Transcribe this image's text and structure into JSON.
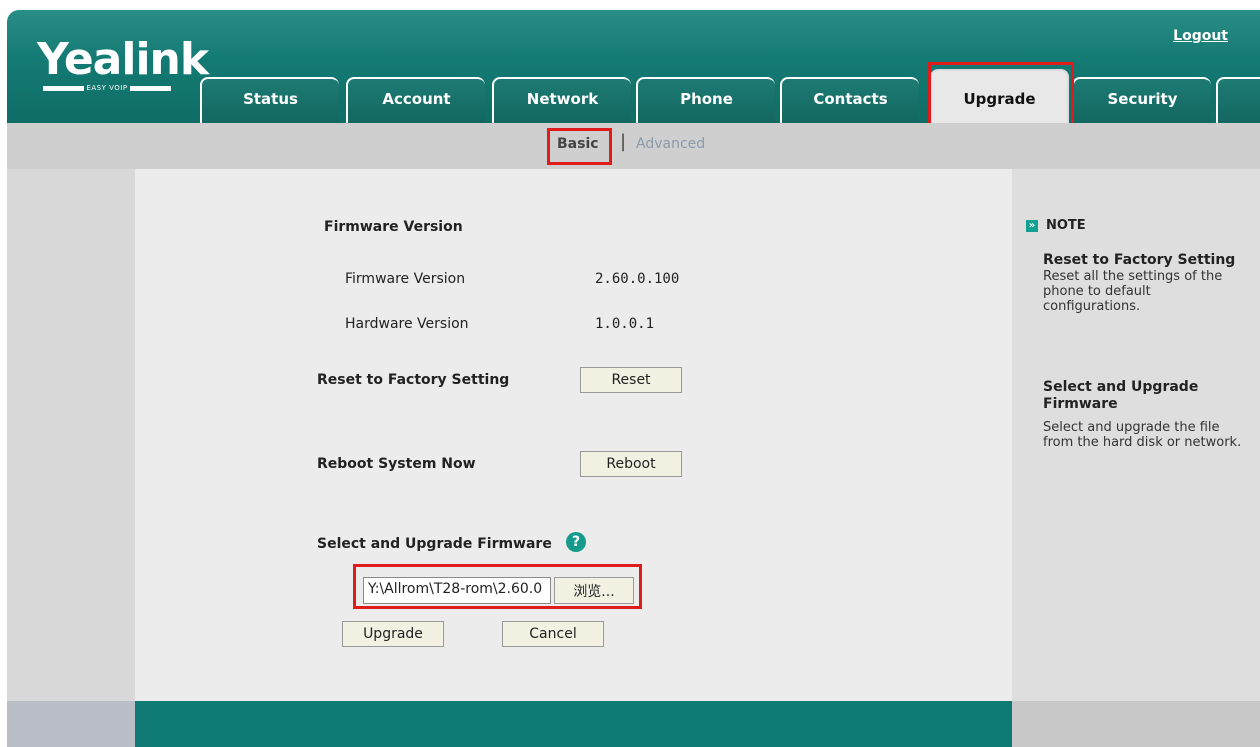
{
  "header": {
    "logo": "Yealink",
    "logo_sub": "EASY VOIP",
    "logout": "Logout",
    "tabs": [
      "Status",
      "Account",
      "Network",
      "Phone",
      "Contacts",
      "Upgrade",
      "Security"
    ],
    "active_tab": "Upgrade"
  },
  "subnav": {
    "basic": "Basic",
    "separator": "|",
    "advanced": "Advanced"
  },
  "main": {
    "firmware_section": "Firmware Version",
    "firmware_version_label": "Firmware Version",
    "firmware_version_value": "2.60.0.100",
    "hardware_version_label": "Hardware Version",
    "hardware_version_value": "1.0.0.1",
    "reset_label": "Reset to Factory Setting",
    "reset_button": "Reset",
    "reboot_label": "Reboot System Now",
    "reboot_button": "Reboot",
    "upgrade_label": "Select and Upgrade Firmware",
    "help_icon": "?",
    "file_path": "Y:\\Allrom\\T28-rom\\2.60.0",
    "browse_button": "浏览...",
    "upgrade_button": "Upgrade",
    "cancel_button": "Cancel"
  },
  "note": {
    "icon": "»",
    "title": "NOTE",
    "reset_heading": "Reset to Factory Setting",
    "reset_text": "Reset all the settings of the phone to default configurations.",
    "upgrade_heading": "Select and Upgrade Firmware",
    "upgrade_text": "Select and upgrade the file from the hard disk or network."
  },
  "colors": {
    "header_teal": "#137a73",
    "highlight_red": "#e01b1b",
    "button_bg": "#f3f1e1"
  }
}
